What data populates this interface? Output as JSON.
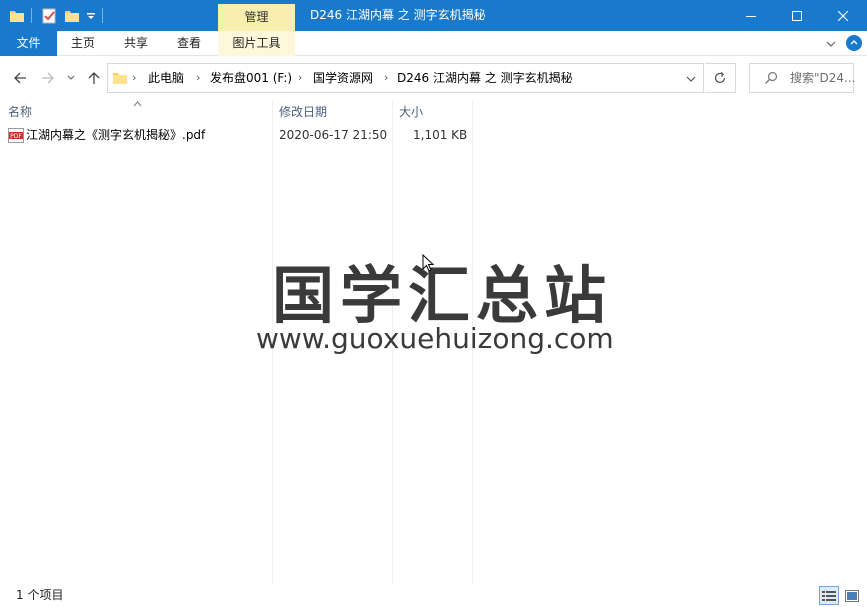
{
  "window": {
    "title": "D246 江湖内幕 之 测字玄机揭秘",
    "context_tab": "管理",
    "title_bar_color": "#1979ca"
  },
  "ribbon": {
    "tabs": [
      "文件",
      "主页",
      "共享",
      "查看",
      "图片工具"
    ]
  },
  "address": {
    "breadcrumbs": [
      "此电脑",
      "发布盘001 (F:)",
      "国学资源网",
      "D246 江湖内幕 之 测字玄机揭秘"
    ]
  },
  "search": {
    "placeholder": "搜索\"D24..."
  },
  "columns": {
    "name": "名称",
    "date": "修改日期",
    "size": "大小"
  },
  "files": [
    {
      "icon": "pdf-file-icon",
      "name": "江湖内幕之《测字玄机揭秘》.pdf",
      "date": "2020-06-17 21:50",
      "size": "1,101 KB"
    }
  ],
  "watermark": {
    "text": "国学汇总站",
    "url": "www.guoxuehuizong.com"
  },
  "status": {
    "item_count": "1 个项目"
  }
}
